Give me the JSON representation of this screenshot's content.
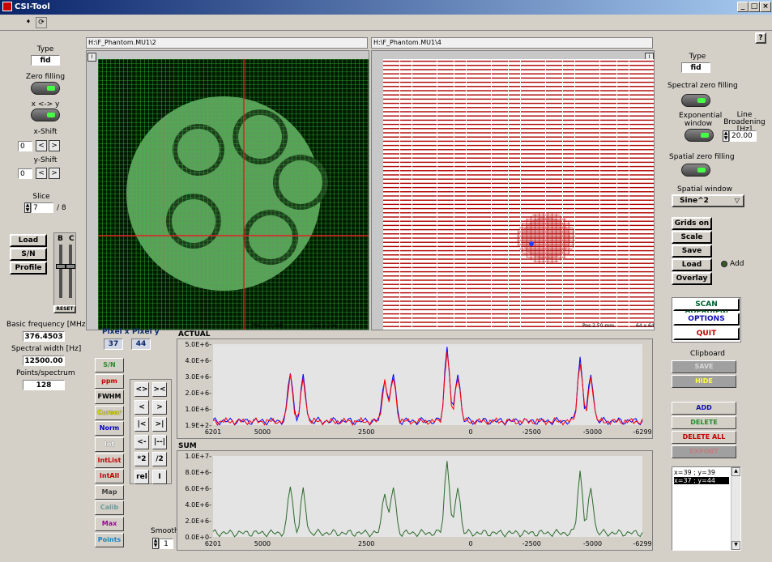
{
  "window": {
    "title": "CSI-Tool",
    "help": "?"
  },
  "left": {
    "type_label": "Type",
    "type_value": "fid",
    "zero_filling": "Zero filling",
    "swap": "x <-> y",
    "x_shift": "x-Shift",
    "x_shift_value": "0",
    "y_shift": "y-Shift",
    "y_shift_value": "0",
    "slice": "Slice",
    "slice_value": "7",
    "slice_total": "/ 8",
    "load": "Load",
    "sn": "S/N",
    "profile": "Profile",
    "b": "B",
    "c": "C",
    "reset": "RESET",
    "basic_freq_label": "Basic frequency [MHz]",
    "basic_freq": "376.4503",
    "spectral_width_label": "Spectral width [Hz]",
    "spectral_width": "12500.00",
    "points_label": "Points/spectrum",
    "points": "128"
  },
  "images": {
    "left_path": "H:\\F_Phantom.MU1\\2",
    "right_path": "H:\\F_Phantom.MU1\\4",
    "left_pos": "Pos 2.50 mm",
    "left_size": "256 x 256",
    "right_pos": "Pos 2.50 mm",
    "right_size": "64 x 64",
    "info": "i"
  },
  "pixel": {
    "x_label": "Pixel x",
    "x": "37",
    "y_label": "Pixel y",
    "y": "44"
  },
  "side_buttons": [
    {
      "label": "S/N",
      "color": "#2a8a2a"
    },
    {
      "label": "ppm",
      "color": "#c00000"
    },
    {
      "label": "FWHM",
      "color": "#000000"
    },
    {
      "label": "Cursor",
      "color": "#e0e000"
    },
    {
      "label": "Norm",
      "color": "#0000c0"
    },
    {
      "label": "Int",
      "color": "#ffffff"
    },
    {
      "label": "IntList",
      "color": "#c00000"
    },
    {
      "label": "IntAll",
      "color": "#c00000"
    },
    {
      "label": "Map",
      "color": "#404040"
    },
    {
      "label": "Calib",
      "color": "#6a9a9a"
    },
    {
      "label": "Max",
      "color": "#a000a0"
    },
    {
      "label": "Points",
      "color": "#2080c0"
    }
  ],
  "nav": [
    "<>",
    "><",
    "<",
    ">",
    "|<",
    ">|",
    "<->",
    "|--|",
    "*2",
    "/2",
    "rel",
    "I"
  ],
  "smooth": {
    "label": "Smooth",
    "value": "1"
  },
  "actual": {
    "title": "ACTUAL",
    "y_ticks": [
      "5.0E+6-",
      "4.0E+6-",
      "3.0E+6-",
      "2.0E+6-",
      "1.0E+6-",
      "1.9E+2-"
    ],
    "x_ticks": [
      "6201",
      "5000",
      "2500",
      "0",
      "-2500",
      "-5000",
      "-6299"
    ]
  },
  "sum": {
    "title": "SUM",
    "y_ticks": [
      "1.0E+7-",
      "8.0E+6-",
      "6.0E+6-",
      "4.0E+6-",
      "2.0E+6-",
      "0.0E+0-"
    ],
    "x_ticks": [
      "6201",
      "5000",
      "2500",
      "0",
      "-2500",
      "-5000",
      "-6299"
    ]
  },
  "right": {
    "type_label": "Type",
    "type_value": "fid",
    "spectral_zero": "Spectral zero filling",
    "exp_window": "Exponential window",
    "line_broadening": "Line Broadening [Hz]",
    "lb_value": "20.00",
    "spatial_zero": "Spatial zero filling",
    "spatial_window": "Spatial window",
    "spatial_window_value": "Sine^2",
    "grids_on": "Grids on",
    "scale": "Scale",
    "save": "Save",
    "load": "Load",
    "overlay": "Overlay",
    "add_led": "Add",
    "scan_overview": "SCAN OVERVIEW",
    "options": "OPTIONS",
    "quit": "QUIT",
    "clipboard": "Clipboard",
    "clip_save": "SAVE",
    "clip_hide": "HIDE",
    "add": "ADD",
    "delete": "DELETE",
    "delete_all": "DELETE ALL",
    "export": "EXPORT",
    "list": [
      "x=39 ; y=39",
      "x=37 ; y=44"
    ]
  },
  "colors": {
    "grid_green": "#1a8a1a",
    "grid_red": "#b00000",
    "spec_blue": "#0000ff",
    "spec_red": "#ff0000",
    "sum_green": "#2a6a2a"
  }
}
